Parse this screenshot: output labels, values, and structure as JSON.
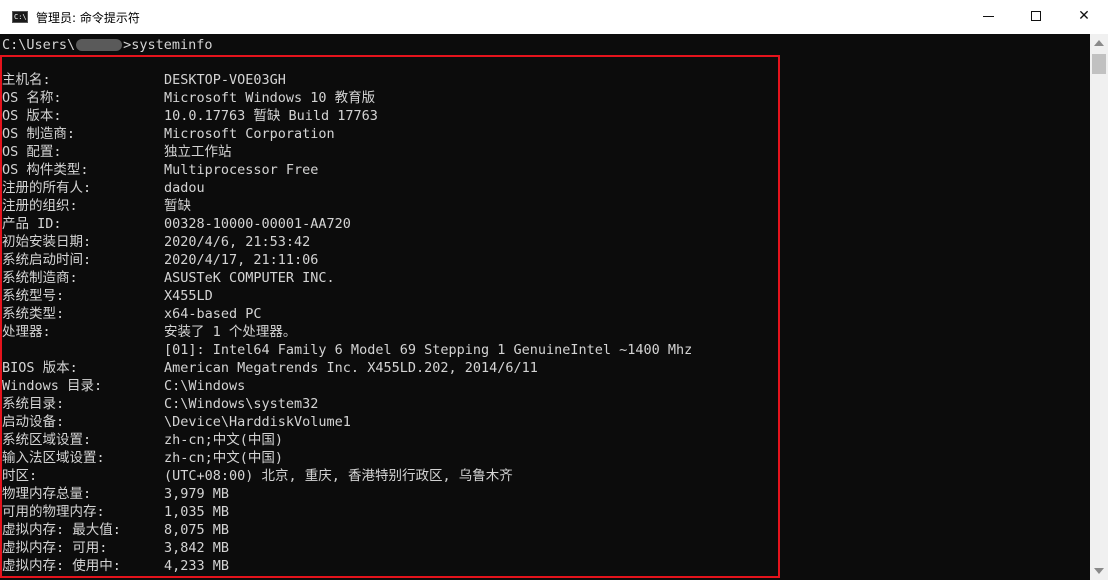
{
  "window": {
    "title": "管理员: 命令提示符",
    "icon": "cmd-icon",
    "icon_glyph": "C:\\",
    "controls": {
      "minimize": "minimize-icon",
      "maximize": "maximize-icon",
      "close": "close-icon",
      "close_glyph": "✕"
    }
  },
  "console": {
    "prompt_prefix": "C:\\Users\\",
    "prompt_suffix": ">systeminfo",
    "rows": [
      {
        "key": "主机名:",
        "value": "DESKTOP-VOE03GH"
      },
      {
        "key": "OS 名称:",
        "value": "Microsoft Windows 10 教育版"
      },
      {
        "key": "OS 版本:",
        "value": "10.0.17763 暂缺 Build 17763"
      },
      {
        "key": "OS 制造商:",
        "value": "Microsoft Corporation"
      },
      {
        "key": "OS 配置:",
        "value": "独立工作站"
      },
      {
        "key": "OS 构件类型:",
        "value": "Multiprocessor Free"
      },
      {
        "key": "注册的所有人:",
        "value": "dadou"
      },
      {
        "key": "注册的组织:",
        "value": "暂缺"
      },
      {
        "key": "产品 ID:",
        "value": "00328-10000-00001-AA720"
      },
      {
        "key": "初始安装日期:",
        "value": "2020/4/6, 21:53:42"
      },
      {
        "key": "系统启动时间:",
        "value": "2020/4/17, 21:11:06"
      },
      {
        "key": "系统制造商:",
        "value": "ASUSTeK COMPUTER INC."
      },
      {
        "key": "系统型号:",
        "value": "X455LD"
      },
      {
        "key": "系统类型:",
        "value": "x64-based PC"
      },
      {
        "key": "处理器:",
        "value": "安装了 1 个处理器。"
      },
      {
        "key": "",
        "value": "[01]: Intel64 Family 6 Model 69 Stepping 1 GenuineIntel ~1400 Mhz"
      },
      {
        "key": "BIOS 版本:",
        "value": "American Megatrends Inc. X455LD.202, 2014/6/11"
      },
      {
        "key": "Windows 目录:",
        "value": "C:\\Windows"
      },
      {
        "key": "系统目录:",
        "value": "C:\\Windows\\system32"
      },
      {
        "key": "启动设备:",
        "value": "\\Device\\HarddiskVolume1"
      },
      {
        "key": "系统区域设置:",
        "value": "zh-cn;中文(中国)"
      },
      {
        "key": "输入法区域设置:",
        "value": "zh-cn;中文(中国)"
      },
      {
        "key": "时区:",
        "value": "(UTC+08:00) 北京, 重庆, 香港特别行政区, 乌鲁木齐"
      },
      {
        "key": "物理内存总量:",
        "value": "3,979 MB"
      },
      {
        "key": "可用的物理内存:",
        "value": "1,035 MB"
      },
      {
        "key": "虚拟内存: 最大值:",
        "value": "8,075 MB"
      },
      {
        "key": "虚拟内存: 可用:",
        "value": "3,842 MB"
      },
      {
        "key": "虚拟内存: 使用中:",
        "value": "4,233 MB"
      }
    ]
  },
  "colors": {
    "console_bg": "#0c0c0c",
    "console_text": "#d4d4d4",
    "highlight": "#e5131c"
  }
}
